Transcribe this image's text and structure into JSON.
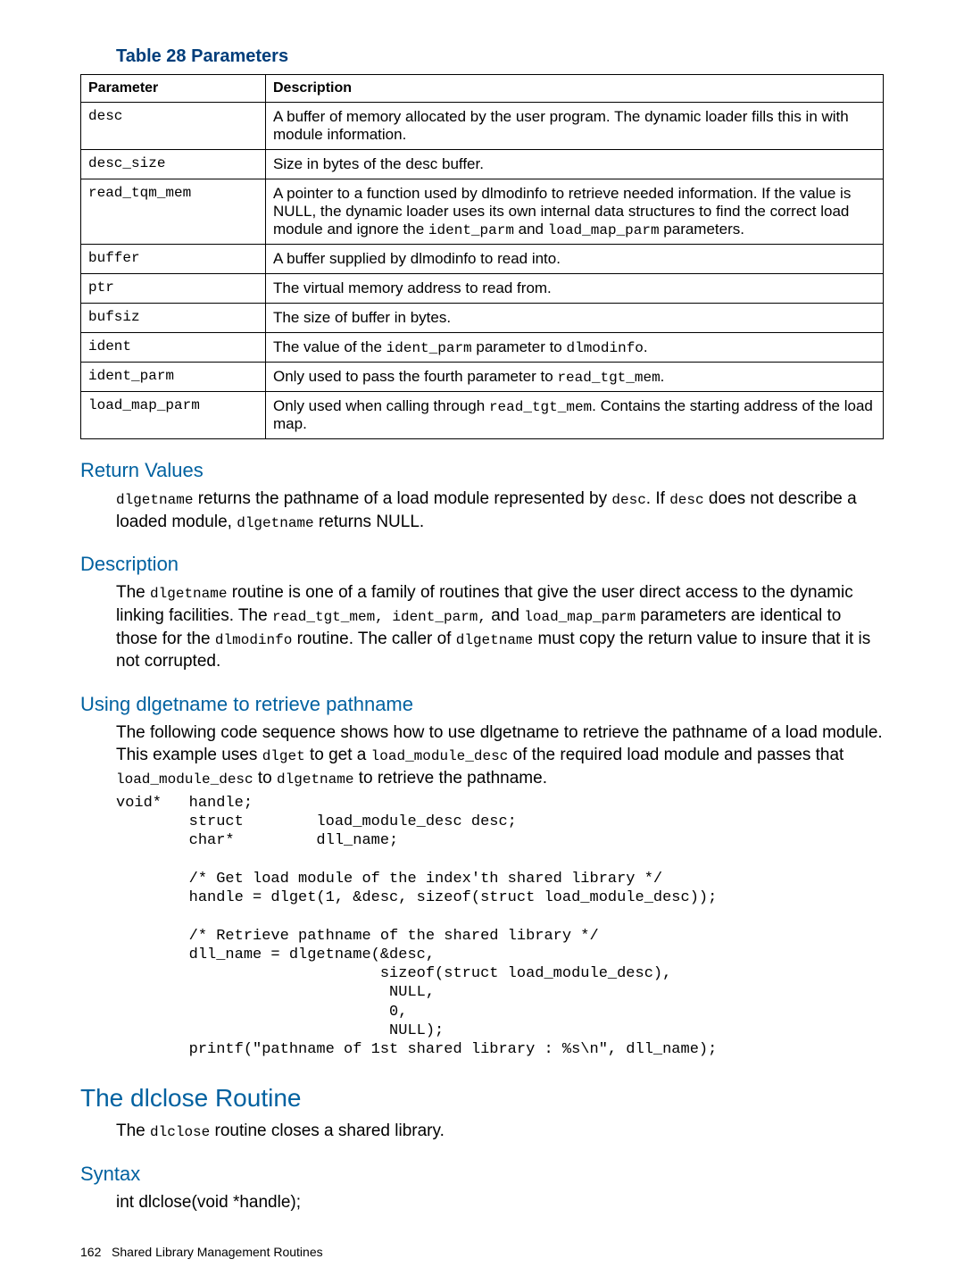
{
  "table": {
    "title": "Table 28 Parameters",
    "headers": {
      "param": "Parameter",
      "desc": "Description"
    },
    "rows": [
      {
        "param": "desc",
        "desc_pre": "A buffer of memory allocated by the user program. The dynamic loader fills this in with module information."
      },
      {
        "param": "desc_size",
        "desc_pre": "Size in bytes of the desc buffer."
      },
      {
        "param": "read_tqm_mem",
        "desc_pre": "A pointer to a function used by dlmodinfo to retrieve needed information. If the value is NULL, the dynamic loader uses its own internal data structures to find the correct load module and ignore the ",
        "code1": "ident_parm",
        "mid": " and ",
        "code2": "load_map_parm",
        "desc_post": " parameters."
      },
      {
        "param": "buffer",
        "desc_pre": "A buffer supplied by dlmodinfo to read into."
      },
      {
        "param": "ptr",
        "desc_pre": "The virtual memory address to read from."
      },
      {
        "param": "bufsiz",
        "desc_pre": "The size of buffer in bytes."
      },
      {
        "param": "ident",
        "desc_pre": "The value of the  ",
        "code1": "ident_parm",
        "mid": " parameter to ",
        "code2": "dlmodinfo",
        "desc_post": "."
      },
      {
        "param": "ident_parm",
        "desc_pre": "Only used to pass the fourth parameter to ",
        "code1": "read_tgt_mem",
        "desc_post": "."
      },
      {
        "param": "load_map_parm",
        "desc_pre": "Only used when calling through ",
        "code1": "read_tgt_mem",
        "desc_post": ". Contains the starting address of the load map."
      }
    ]
  },
  "return_values": {
    "heading": "Return Values",
    "p1a": "dlgetname",
    "p1b": " returns the pathname of a load module represented by ",
    "p1c": "desc",
    "p1d": ". If ",
    "p1e": "desc",
    "p1f": " does not describe a loaded module, ",
    "p1g": "dlgetname",
    "p1h": " returns NULL."
  },
  "description": {
    "heading": "Description",
    "t1": "The ",
    "c1": "dlgetname",
    "t2": " routine is one of a family of routines that give the user direct access to the dynamic linking facilities. The ",
    "c2": "read_tgt_mem, ident_parm,",
    "t3": " and ",
    "c3": "load_map_parm",
    "t4": " parameters are identical to those for the ",
    "c4": "dlmodinfo",
    "t5": " routine. The caller of ",
    "c5": "dlgetname",
    "t6": " must copy the return value to insure that it is not corrupted."
  },
  "using": {
    "heading": "Using dlgetname to retrieve pathname",
    "t1": "The following code sequence shows how to use dlgetname to retrieve the pathname of a load module. This example uses ",
    "c1": "dlget",
    "t2": " to get a ",
    "c2": "load_module_desc",
    "t3": " of the required load module and passes that ",
    "c3": "load_module_desc",
    "t4": " to ",
    "c4": "dlgetname",
    "t5": " to retrieve the pathname.",
    "code": "void*   handle;\n        struct        load_module_desc desc;\n        char*         dll_name;\n\n        /* Get load module of the index'th shared library */\n        handle = dlget(1, &desc, sizeof(struct load_module_desc));\n\n        /* Retrieve pathname of the shared library */\n        dll_name = dlgetname(&desc,\n                             sizeof(struct load_module_desc),\n                              NULL,\n                              0,\n                              NULL);\n        printf(\"pathname of 1st shared library : %s\\n\", dll_name);"
  },
  "dlclose": {
    "heading": "The dlclose Routine",
    "t1": "The ",
    "c1": "dlclose",
    "t2": " routine closes a shared library."
  },
  "syntax": {
    "heading": "Syntax",
    "line": "int dlclose(void *handle);"
  },
  "footer": {
    "page": "162",
    "section": "Shared Library Management Routines"
  }
}
